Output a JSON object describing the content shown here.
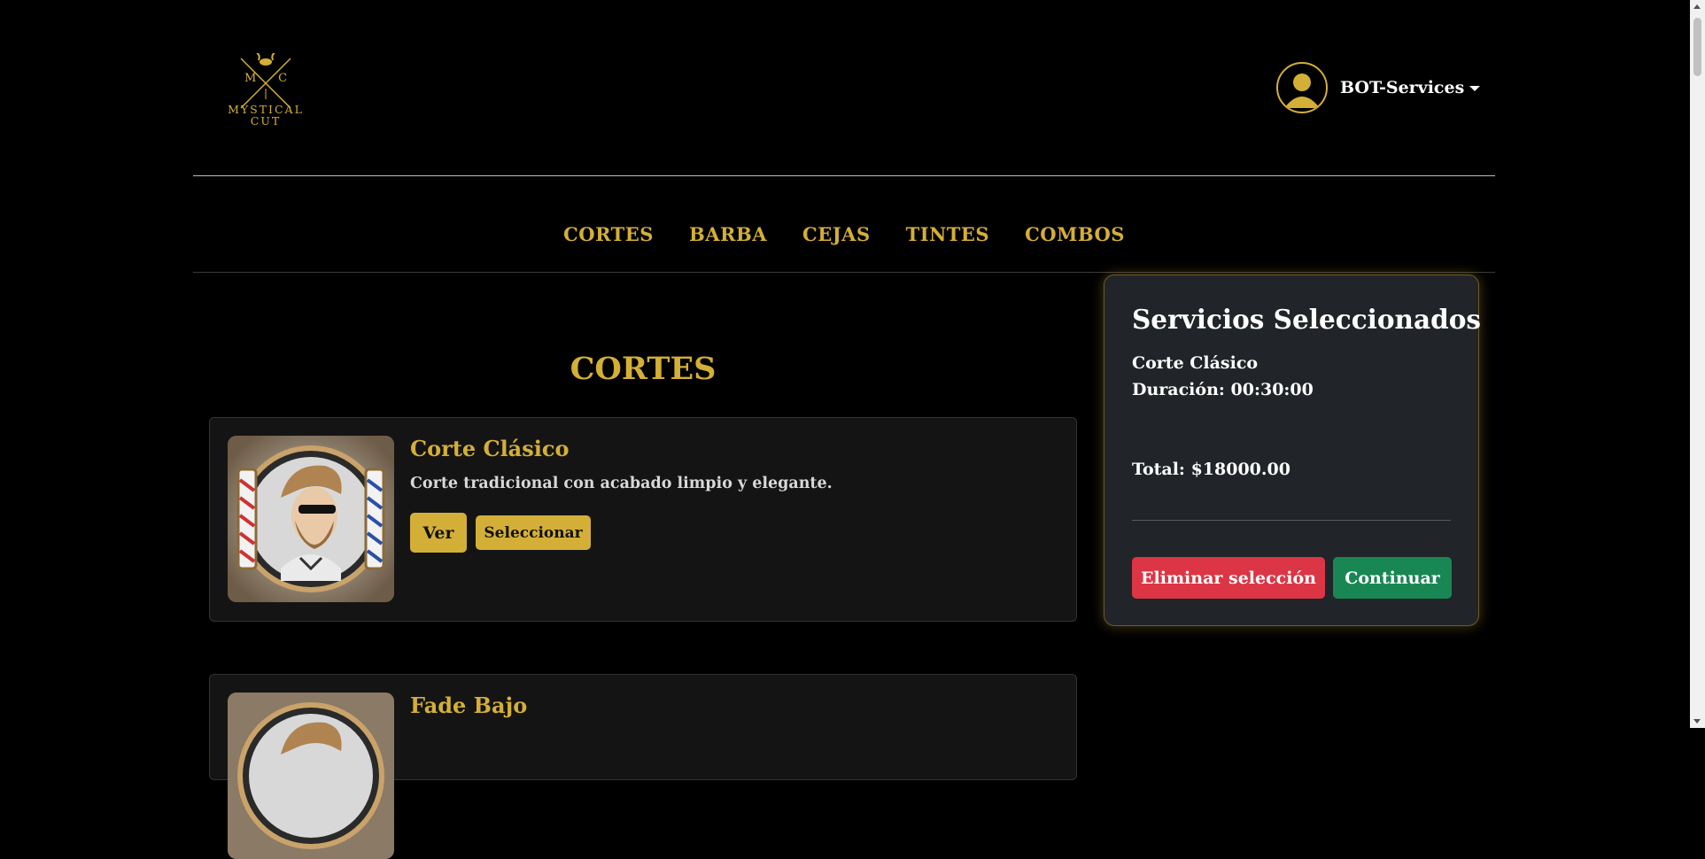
{
  "header": {
    "logo_top": "M      C",
    "logo_line1": "MYSTICAL",
    "logo_line2": "CUT",
    "username": "BOT-Services"
  },
  "nav": {
    "items": [
      "CORTES",
      "BARBA",
      "CEJAS",
      "TINTES",
      "COMBOS"
    ]
  },
  "section": {
    "title": "CORTES"
  },
  "services": [
    {
      "name": "Corte Clásico",
      "description": "Corte tradicional con acabado limpio y elegante.",
      "view_label": "Ver",
      "select_label": "Seleccionar"
    },
    {
      "name": "Fade Bajo"
    }
  ],
  "panel": {
    "title": "Servicios Seleccionados",
    "selected_name": "Corte Clásico",
    "duration": "Duración: 00:30:00",
    "total": "Total: $18000.00",
    "delete_label": "Eliminar selección",
    "continue_label": "Continuar"
  },
  "colors": {
    "accent": "#d4af37",
    "danger": "#dc3545",
    "success": "#198754",
    "panel_bg": "#212428",
    "card_bg": "#141414"
  }
}
